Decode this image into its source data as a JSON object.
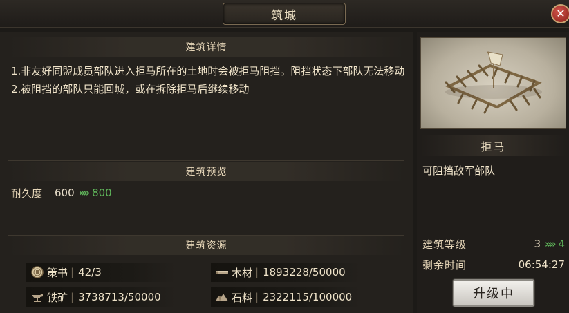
{
  "window": {
    "title": "筑城",
    "close_label": "✕"
  },
  "details": {
    "header": "建筑详情",
    "line1": "1.非友好同盟成员部队进入拒马所在的土地时会被拒马阻挡。阻挡状态下部队无法移动",
    "line2": "2.被阻挡的部队只能回城，或在拆除拒马后继续移动"
  },
  "preview": {
    "header": "建筑预览",
    "durability_label": "耐久度",
    "durability_from": "600",
    "durability_to": "800",
    "arrow_glyph": "»"
  },
  "resources": {
    "header": "建筑资源",
    "items": [
      {
        "icon": "token-icon",
        "name": "策书",
        "amount": "42/3"
      },
      {
        "icon": "wood-icon",
        "name": "木材",
        "amount": "1893228/50000"
      },
      {
        "icon": "iron-icon",
        "name": "铁矿",
        "amount": "3738713/50000"
      },
      {
        "icon": "stone-icon",
        "name": "石料",
        "amount": "2322115/100000"
      }
    ],
    "separator": "|"
  },
  "building": {
    "name": "拒马",
    "description": "可阻挡敌军部队",
    "level_label": "建筑等级",
    "level_from": "3",
    "level_to": "4",
    "time_label": "剩余时间",
    "time_value": "06:54:27",
    "upgrade_button": "升级中"
  },
  "colors": {
    "increase": "#5fb55a",
    "text": "#efe3c9",
    "close": "#b23a30"
  }
}
